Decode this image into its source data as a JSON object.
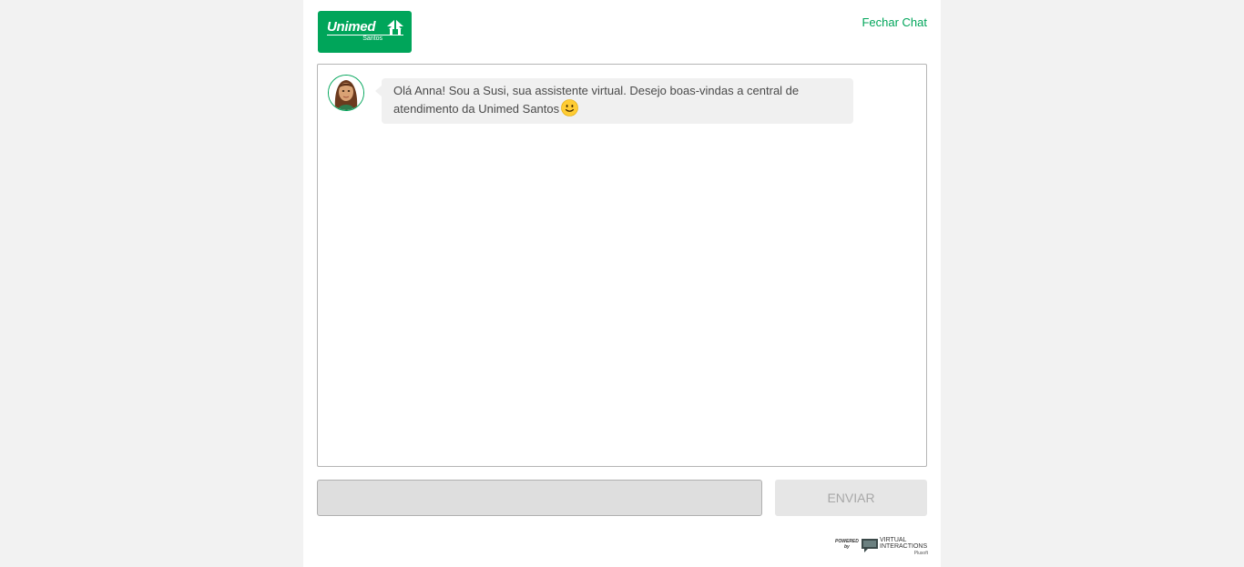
{
  "header": {
    "logo_word": "Unimed",
    "logo_sub": "Santos",
    "close_label": "Fechar Chat"
  },
  "colors": {
    "brand": "#00a55a",
    "bubble_bg": "#f0f0f0",
    "input_bg": "#dedede",
    "send_bg": "#e6e6e6"
  },
  "chat": {
    "messages": [
      {
        "sender": "bot",
        "avatar": "susi-avatar-icon",
        "text": "Olá Anna! Sou a Susi, sua assistente virtual. Desejo boas-vindas a central de atendimento da Unimed Santos",
        "emoji": "slightly-smiling-face-icon"
      }
    ]
  },
  "composer": {
    "input_value": "",
    "send_label": "ENVIAR"
  },
  "footer": {
    "powered_label_1": "POWERED",
    "powered_label_2": "by",
    "brand_line_1": "VIRTUAL",
    "brand_line_2": "INTERACTIONS",
    "brand_line_3": "Plusoft"
  }
}
